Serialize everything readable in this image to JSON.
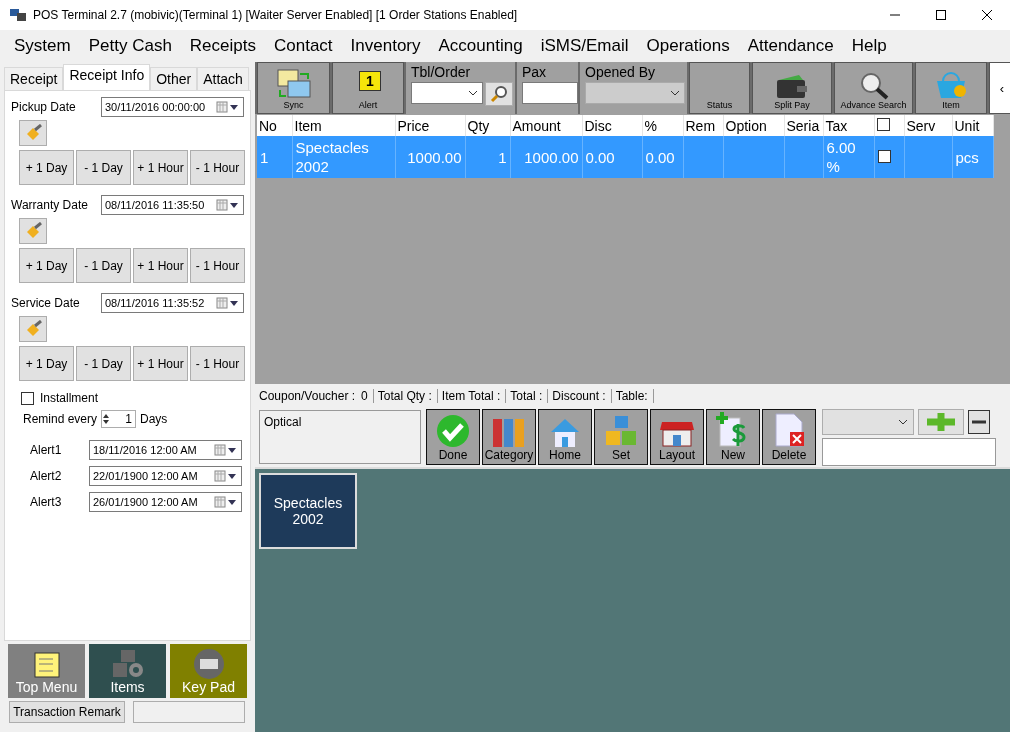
{
  "window": {
    "title": "POS Terminal 2.7 (mobivic)(Terminal 1) [Waiter Server Enabled] [1 Order Stations Enabled]"
  },
  "menu": [
    "System",
    "Petty Cash",
    "Receipts",
    "Contact",
    "Inventory",
    "Accounting",
    "iSMS/Email",
    "Operations",
    "Attendance",
    "Help"
  ],
  "side_tabs": [
    {
      "label": "Receipt",
      "selected": false
    },
    {
      "label": "Receipt Info",
      "selected": true
    },
    {
      "label": "Other",
      "selected": false
    },
    {
      "label": "Attach",
      "selected": false
    }
  ],
  "date_groups": [
    {
      "label": "Pickup Date",
      "value": "30/11/2016 00:00:00",
      "buttons": [
        "+ 1 Day",
        "- 1 Day",
        "+ 1 Hour",
        "- 1 Hour"
      ]
    },
    {
      "label": "Warranty Date",
      "value": "08/11/2016 11:35:50",
      "buttons": [
        "+ 1 Day",
        "- 1 Day",
        "+ 1 Hour",
        "- 1 Hour"
      ]
    },
    {
      "label": "Service Date",
      "value": "08/11/2016 11:35:52",
      "buttons": [
        "+ 1 Day",
        "- 1 Day",
        "+ 1 Hour",
        "- 1 Hour"
      ]
    }
  ],
  "installment": {
    "label": "Installment",
    "checked": false
  },
  "remind": {
    "label": "Remind every",
    "value": "1",
    "unit": "Days"
  },
  "alerts": [
    {
      "label": "Alert1",
      "value": "18/11/2016 12:00 AM"
    },
    {
      "label": "Alert2",
      "value": "22/01/1900 12:00 AM"
    },
    {
      "label": "Alert3",
      "value": "26/01/1900 12:00 AM"
    }
  ],
  "side_tiles": [
    {
      "label": "Top Menu",
      "color": "#808080",
      "kind": "folder"
    },
    {
      "label": "Items",
      "color": "#2f4f4f",
      "kind": "boxes"
    },
    {
      "label": "Key Pad",
      "color": "#808000",
      "kind": "keyboard"
    }
  ],
  "transaction_remark": {
    "label": "Transaction Remark"
  },
  "toolbar": [
    {
      "kind": "sync",
      "label": "Sync"
    },
    {
      "kind": "alert",
      "label": "Alert",
      "badge": "1"
    },
    {
      "kind": "combo_search",
      "label": "Tbl/Order"
    },
    {
      "kind": "input",
      "label": "Pax"
    },
    {
      "kind": "combo",
      "label": "Opened By",
      "disabled": true
    },
    {
      "kind": "plain",
      "label": "Status"
    },
    {
      "kind": "wallet",
      "label": "Split Pay"
    },
    {
      "kind": "search",
      "label": "Advance Search"
    },
    {
      "kind": "basket",
      "label": "Item"
    },
    {
      "kind": "scroll",
      "label": "‹"
    }
  ],
  "table": {
    "columns": [
      {
        "label": "No"
      },
      {
        "label": "Item"
      },
      {
        "label": "Price"
      },
      {
        "label": "Qty"
      },
      {
        "label": "Amount"
      },
      {
        "label": "Disc"
      },
      {
        "label": "%"
      },
      {
        "label": "Rem"
      },
      {
        "label": "Option"
      },
      {
        "label": "Seria"
      },
      {
        "label": "Tax"
      },
      {
        "kind": "checkbox",
        "checked": false
      },
      {
        "label": "Serv"
      },
      {
        "label": "Unit"
      }
    ],
    "rows": [
      {
        "selected": true,
        "checked": false,
        "cells": [
          "1",
          "Spectacles 2002",
          "1000.00",
          "1",
          "1000.00",
          "0.00",
          "0.00",
          "",
          "",
          "",
          "6.00 %",
          "",
          "",
          "pcs"
        ]
      }
    ]
  },
  "totals": [
    {
      "label": "Coupon/Voucher :",
      "value": "0"
    },
    {
      "label": "Total Qty :"
    },
    {
      "label": "Item Total :"
    },
    {
      "label": "Total :"
    },
    {
      "label": "Discount :"
    },
    {
      "label": "Table:"
    }
  ],
  "category_field": {
    "value": "Optical"
  },
  "actions": [
    {
      "kind": "done",
      "label": "Done"
    },
    {
      "kind": "category",
      "label": "Category"
    },
    {
      "kind": "home",
      "label": "Home"
    },
    {
      "kind": "set",
      "label": "Set"
    },
    {
      "kind": "layout",
      "label": "Layout"
    },
    {
      "kind": "new",
      "label": "New"
    },
    {
      "kind": "delete",
      "label": "Delete"
    }
  ],
  "products": [
    {
      "label": "Spectacles 2002"
    }
  ]
}
